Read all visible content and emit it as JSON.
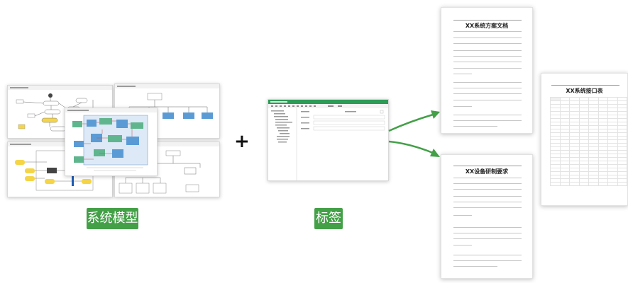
{
  "labels": {
    "system_model": "系统模型",
    "plus": "+",
    "tag": "标签"
  },
  "documents": {
    "solution_doc_title": "XX系统方案文档",
    "device_requirements_title": "XX设备研制要求",
    "interface_table_title": "XX系统接口表"
  },
  "colors": {
    "label_green": "#43a047",
    "arrow_green": "#43a047",
    "model_block_blue": "#5b9bd5",
    "model_block_yellow": "#f5d547",
    "form_header_green": "#2e9b57"
  }
}
